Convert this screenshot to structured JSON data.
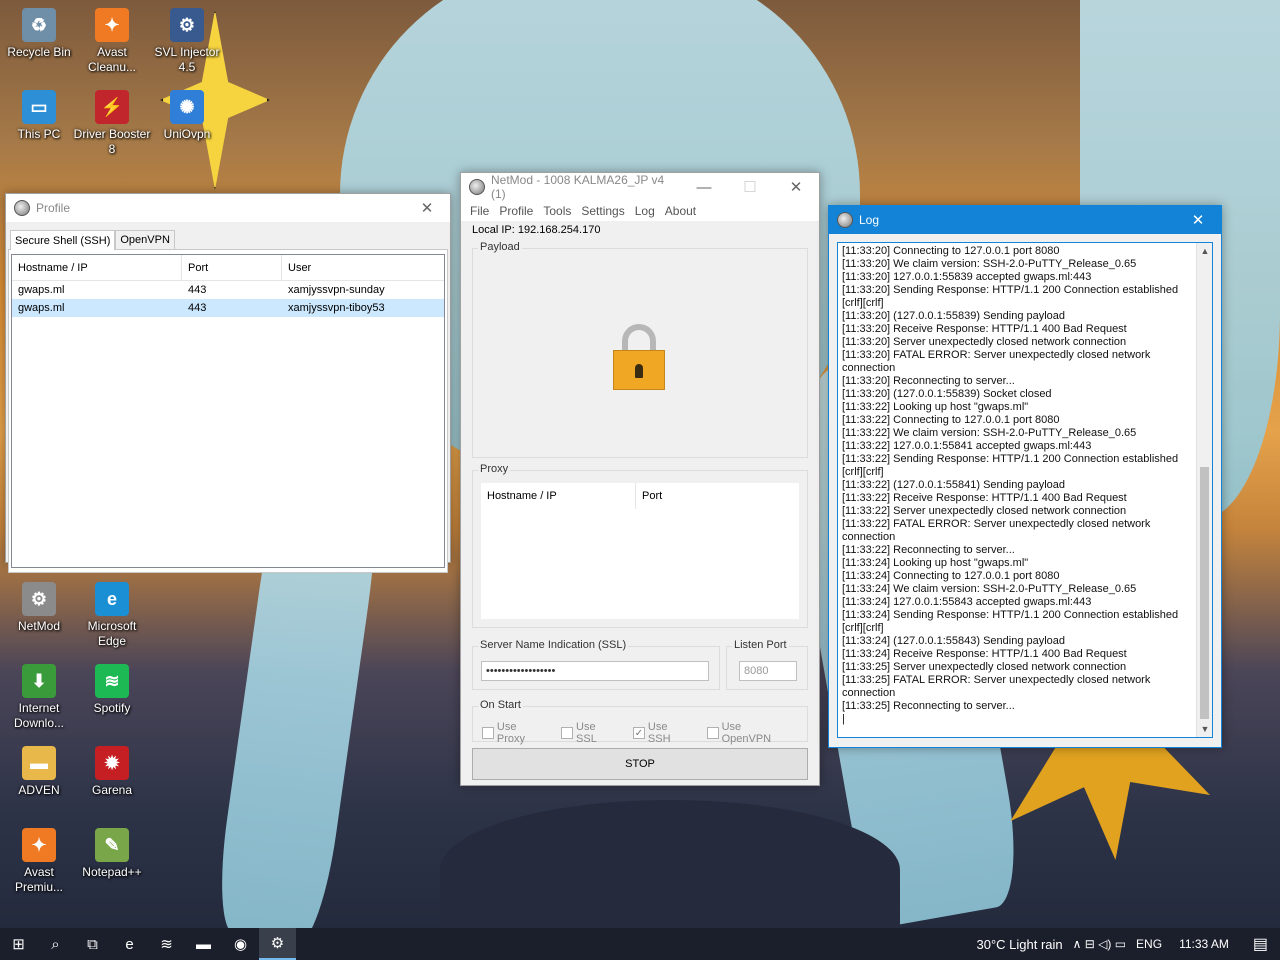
{
  "desktop": {
    "icons": [
      {
        "label": "Recycle Bin",
        "glyph": "♻",
        "color": "#6f8fa8"
      },
      {
        "label": "Avast Cleanu...",
        "glyph": "✦",
        "color": "#f07a23"
      },
      {
        "label": "SVL Injector 4.5",
        "glyph": "⚙",
        "color": "#385a8f"
      },
      {
        "label": "This PC",
        "glyph": "▭",
        "color": "#2d8fd5"
      },
      {
        "label": "Driver Booster 8",
        "glyph": "⚡",
        "color": "#c0262c"
      },
      {
        "label": "UniOvpn",
        "glyph": "✺",
        "color": "#2f7fd9"
      },
      {
        "label": "NetMod",
        "glyph": "⚙",
        "color": "#8b8b8b"
      },
      {
        "label": "Microsoft Edge",
        "glyph": "e",
        "color": "#1a8fd3"
      },
      {
        "label": "Internet Downlo...",
        "glyph": "⬇",
        "color": "#3a9b3a"
      },
      {
        "label": "Spotify",
        "glyph": "≋",
        "color": "#1db954"
      },
      {
        "label": "ADVEN",
        "glyph": "▬",
        "color": "#e8b94a"
      },
      {
        "label": "Garena",
        "glyph": "✹",
        "color": "#c51f24"
      },
      {
        "label": "Avast Premiu...",
        "glyph": "✦",
        "color": "#f07a23"
      },
      {
        "label": "Notepad++",
        "glyph": "✎",
        "color": "#7aa64a"
      }
    ]
  },
  "profile_window": {
    "title": "Profile",
    "close": "✕",
    "tabs": [
      {
        "label": "Secure Shell (SSH)"
      },
      {
        "label": "OpenVPN"
      }
    ],
    "columns": [
      "Hostname / IP",
      "Port",
      "User"
    ],
    "rows": [
      {
        "host": "gwaps.ml",
        "port": "443",
        "user": "xamjyssvpn-sunday"
      },
      {
        "host": "gwaps.ml",
        "port": "443",
        "user": "xamjyssvpn-tiboy53"
      }
    ]
  },
  "netmod_window": {
    "title": "NetMod - 1008 KALMA26_JP v4 (1)",
    "minimize": "—",
    "maximize": "☐",
    "close": "✕",
    "menu": [
      "File",
      "Profile",
      "Tools",
      "Settings",
      "Log",
      "About"
    ],
    "local_ip_label": "Local IP: 192.168.254.170",
    "payload_title": "Payload",
    "proxy_title": "Proxy",
    "proxy_columns": [
      "Hostname / IP",
      "Port"
    ],
    "sni_title": "Server Name Indication (SSL)",
    "sni_value": "••••••••••••••••••",
    "listen_port_title": "Listen Port",
    "listen_port_value": "8080",
    "on_start_title": "On Start",
    "options": [
      {
        "label": "Use Proxy",
        "checked": ""
      },
      {
        "label": "Use SSL",
        "checked": ""
      },
      {
        "label": "Use SSH",
        "checked": "✓"
      },
      {
        "label": "Use OpenVPN",
        "checked": ""
      }
    ],
    "stop_label": "STOP"
  },
  "log_window": {
    "title": "Log",
    "close": "✕",
    "lines": "[11:33:20] Connecting to 127.0.0.1 port 8080\n[11:33:20] We claim version: SSH-2.0-PuTTY_Release_0.65\n[11:33:20] 127.0.0.1:55839 accepted gwaps.ml:443\n[11:33:20] Sending Response: HTTP/1.1 200 Connection established\n[crlf][crlf]\n[11:33:20] (127.0.0.1:55839) Sending payload\n[11:33:20] Receive Response: HTTP/1.1 400 Bad Request\n[11:33:20] Server unexpectedly closed network connection\n[11:33:20] FATAL ERROR: Server unexpectedly closed network\nconnection\n[11:33:20] Reconnecting to server...\n[11:33:20] (127.0.0.1:55839) Socket closed\n[11:33:22] Looking up host \"gwaps.ml\"\n[11:33:22] Connecting to 127.0.0.1 port 8080\n[11:33:22] We claim version: SSH-2.0-PuTTY_Release_0.65\n[11:33:22] 127.0.0.1:55841 accepted gwaps.ml:443\n[11:33:22] Sending Response: HTTP/1.1 200 Connection established\n[crlf][crlf]\n[11:33:22] (127.0.0.1:55841) Sending payload\n[11:33:22] Receive Response: HTTP/1.1 400 Bad Request\n[11:33:22] Server unexpectedly closed network connection\n[11:33:22] FATAL ERROR: Server unexpectedly closed network\nconnection\n[11:33:22] Reconnecting to server...\n[11:33:24] Looking up host \"gwaps.ml\"\n[11:33:24] Connecting to 127.0.0.1 port 8080\n[11:33:24] We claim version: SSH-2.0-PuTTY_Release_0.65\n[11:33:24] 127.0.0.1:55843 accepted gwaps.ml:443\n[11:33:24] Sending Response: HTTP/1.1 200 Connection established\n[crlf][crlf]\n[11:33:24] (127.0.0.1:55843) Sending payload\n[11:33:24] Receive Response: HTTP/1.1 400 Bad Request\n[11:33:25] Server unexpectedly closed network connection\n[11:33:25] FATAL ERROR: Server unexpectedly closed network\nconnection\n[11:33:25] Reconnecting to server...\n|"
  },
  "taskbar": {
    "items": [
      {
        "name": "start-icon",
        "glyph": "⊞"
      },
      {
        "name": "search-icon",
        "glyph": "⌕"
      },
      {
        "name": "task-view-icon",
        "glyph": "⧉"
      },
      {
        "name": "edge-icon",
        "glyph": "e"
      },
      {
        "name": "spotify-icon",
        "glyph": "≋"
      },
      {
        "name": "file-explorer-icon",
        "glyph": "▬"
      },
      {
        "name": "chrome-icon",
        "glyph": "◉"
      },
      {
        "name": "netmod-icon",
        "glyph": "⚙"
      }
    ],
    "weather": "30°C  Light rain",
    "tray_glyphs": "∧  ⊟  ◁)  ▭",
    "language": "ENG",
    "time": "11:33 AM",
    "notification": "▤"
  }
}
